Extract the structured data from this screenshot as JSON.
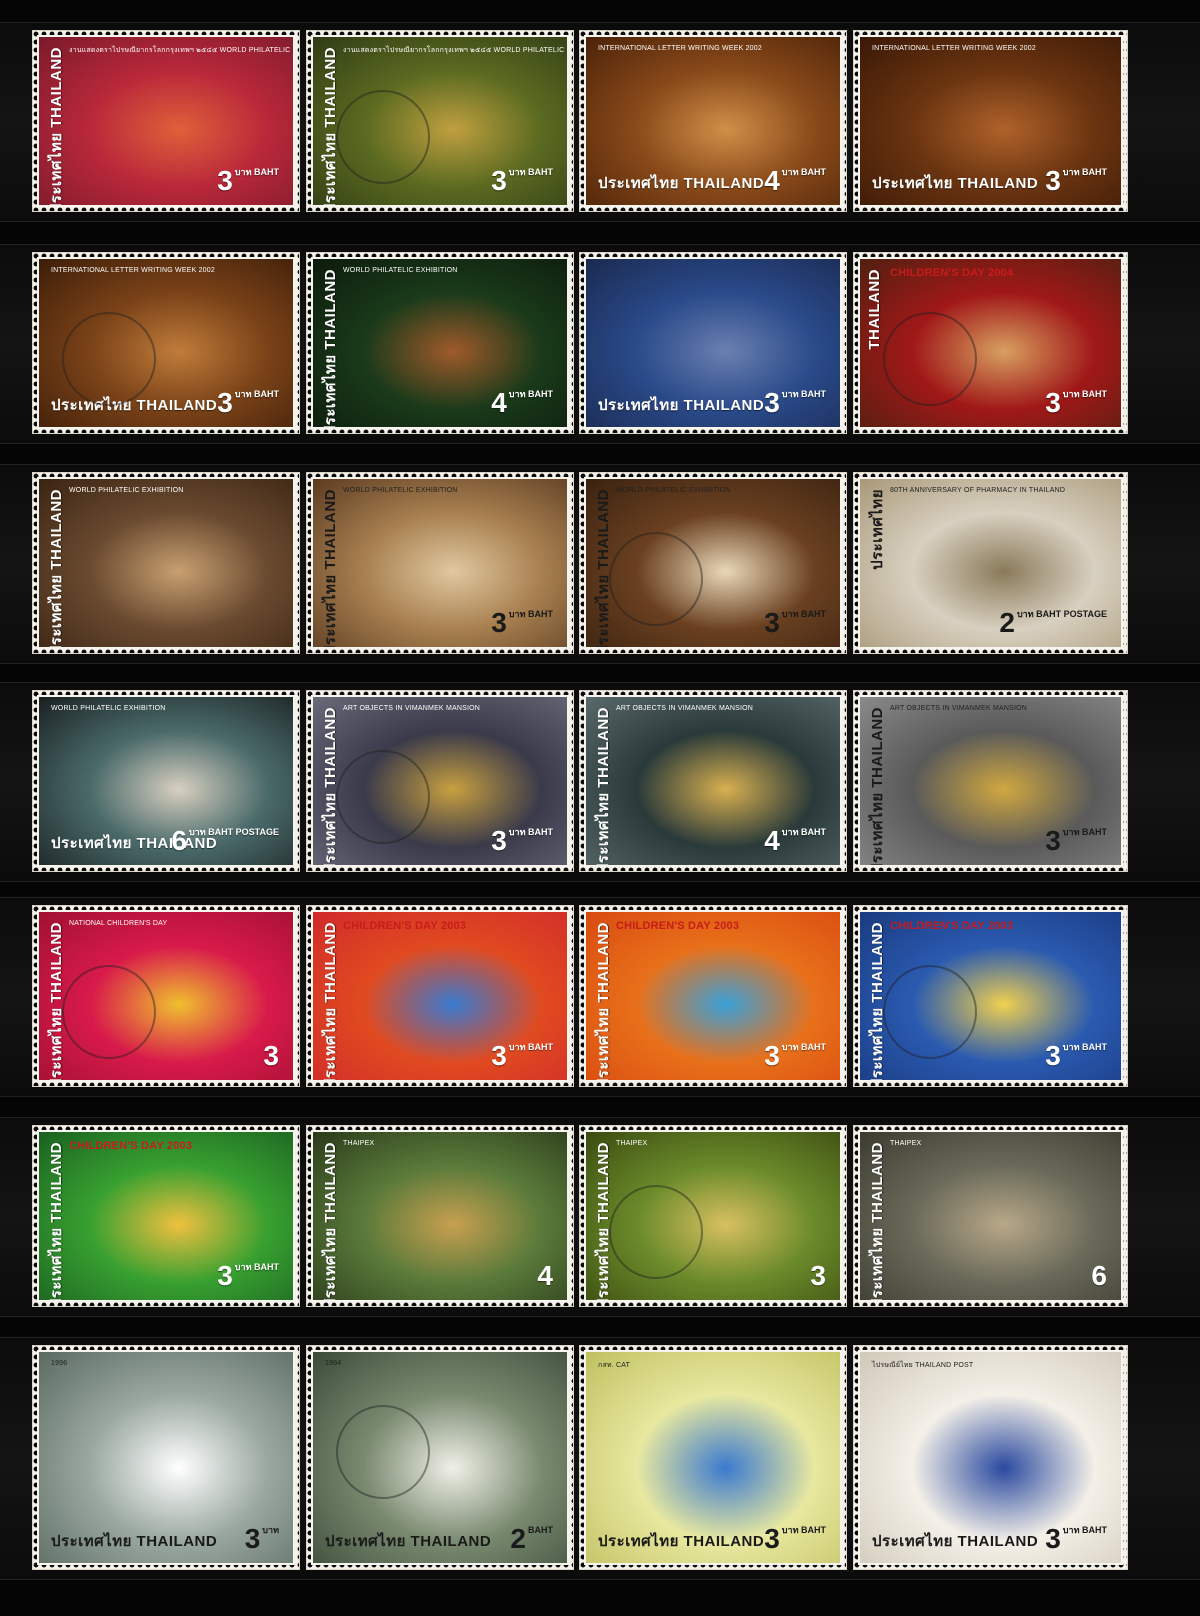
{
  "album": {
    "rows": [
      {
        "stamps": [
          {
            "country": "ประเทศไทย THAILAND",
            "value": "3",
            "unit": "บาท BAHT",
            "caption": "งานแสดงตราไปรษณียากรโลกกรุงเทพฯ ๒๕๔๕ WORLD PHILATELIC EXHIBITION",
            "theme": "food-red"
          },
          {
            "country": "ประเทศไทย THAILAND",
            "value": "3",
            "unit": "บาท BAHT",
            "caption": "งานแสดงตราไปรษณียากรโลกกรุงเทพฯ ๒๕๔๕ WORLD PHILATELIC EXHIBITION",
            "theme": "food-green"
          },
          {
            "country": "ประเทศไทย THAILAND",
            "value": "4",
            "unit": "บาท BAHT",
            "caption": "INTERNATIONAL LETTER WRITING WEEK 2002",
            "theme": "wood-ladle"
          },
          {
            "country": "ประเทศไทย THAILAND",
            "value": "3",
            "unit": "บาท BAHT",
            "caption": "INTERNATIONAL LETTER WRITING WEEK 2002",
            "theme": "wood-frog"
          }
        ]
      },
      {
        "stamps": [
          {
            "country": "ประเทศไทย THAILAND",
            "value": "3",
            "unit": "บาท BAHT",
            "caption": "INTERNATIONAL LETTER WRITING WEEK 2002",
            "theme": "wood-sieve"
          },
          {
            "country": "ประเทศไทย THAILAND",
            "value": "4",
            "unit": "บาท BAHT",
            "caption": "WORLD PHILATELIC EXHIBITION",
            "theme": "food-dark"
          },
          {
            "country": "ประเทศไทย THAILAND",
            "value": "3",
            "unit": "บาท BAHT",
            "caption": "",
            "theme": "painting-blue"
          },
          {
            "country": "THAILAND",
            "value": "3",
            "unit": "บาท BAHT",
            "caption": "CHILDREN'S DAY 2004",
            "theme": "cartoon-red"
          }
        ]
      },
      {
        "stamps": [
          {
            "country": "ประเทศไทย THAILAND",
            "value": "",
            "unit": "",
            "caption": "WORLD PHILATELIC EXHIBITION",
            "theme": "pottery"
          },
          {
            "country": "ประเทศไทย THAILAND",
            "value": "3",
            "unit": "บาท BAHT",
            "caption": "WORLD PHILATELIC EXHIBITION",
            "theme": "basket"
          },
          {
            "country": "ประเทศไทย THAILAND",
            "value": "3",
            "unit": "บาท BAHT",
            "caption": "WORLD PHILATELIC EXHIBITION",
            "theme": "puppet"
          },
          {
            "country": "ประเทศไทย",
            "value": "2",
            "unit": "บาท BAHT POSTAGE",
            "caption": "80TH ANNIVERSARY OF PHARMACY IN THAILAND",
            "theme": "grinder"
          }
        ]
      },
      {
        "stamps": [
          {
            "country": "ประเทศไทย THAILAND",
            "value": "6",
            "unit": "บาท BAHT POSTAGE",
            "caption": "WORLD PHILATELIC EXHIBITION",
            "theme": "vases"
          },
          {
            "country": "ประเทศไทย THAILAND",
            "value": "3",
            "unit": "บาท BAHT",
            "caption": "ART OBJECTS IN VIMANMEK MANSION",
            "theme": "gold-box"
          },
          {
            "country": "ประเทศไทย THAILAND",
            "value": "4",
            "unit": "บาท BAHT",
            "caption": "ART OBJECTS IN VIMANMEK MANSION",
            "theme": "gold-bowl"
          },
          {
            "country": "ประเทศไทย THAILAND",
            "value": "3",
            "unit": "บาท BAHT",
            "caption": "ART OBJECTS IN VIMANMEK MANSION",
            "theme": "gold-bowl2"
          }
        ]
      },
      {
        "stamps": [
          {
            "country": "ประเทศไทย THAILAND",
            "value": "3",
            "unit": "",
            "caption": "NATIONAL CHILDREN'S DAY",
            "theme": "kids-red"
          },
          {
            "country": "ประเทศไทย THAILAND",
            "value": "3",
            "unit": "บาท BAHT",
            "caption": "CHILDREN'S DAY 2003",
            "theme": "kids-temple"
          },
          {
            "country": "ประเทศไทย THAILAND",
            "value": "3",
            "unit": "บาท BAHT",
            "caption": "CHILDREN'S DAY 2003",
            "theme": "kids-city"
          },
          {
            "country": "ประเทศไทย THAILAND",
            "value": "3",
            "unit": "บาท BAHT",
            "caption": "CHILDREN'S DAY 2003",
            "theme": "kids-swing"
          }
        ]
      },
      {
        "stamps": [
          {
            "country": "ประเทศไทย THAILAND",
            "value": "3",
            "unit": "บาท BAHT",
            "caption": "CHILDREN'S DAY 2003",
            "theme": "kids-green"
          },
          {
            "country": "ประเทศไทย THAILAND",
            "value": "4",
            "unit": "",
            "caption": "THAIPEX",
            "theme": "rooster1"
          },
          {
            "country": "ประเทศไทย THAILAND",
            "value": "3",
            "unit": "",
            "caption": "THAIPEX",
            "theme": "rooster2"
          },
          {
            "country": "ประเทศไทย THAILAND",
            "value": "6",
            "unit": "",
            "caption": "THAIPEX",
            "theme": "rooster3"
          }
        ]
      },
      {
        "stamps": [
          {
            "country": "ประเทศไทย THAILAND",
            "value": "3",
            "unit": "บาท",
            "caption": "1996",
            "theme": "dino1"
          },
          {
            "country": "ประเทศไทย THAILAND",
            "value": "2",
            "unit": "BAHT",
            "caption": "1994",
            "theme": "dino2"
          },
          {
            "country": "ประเทศไทย THAILAND",
            "value": "3",
            "unit": "บาท BAHT",
            "caption": "กสท. CAT",
            "theme": "cat25"
          },
          {
            "country": "ประเทศไทย THAILAND",
            "value": "3",
            "unit": "บาท BAHT",
            "caption": "ไปรษณีย์ไทย THAILAND POST",
            "theme": "post"
          }
        ]
      }
    ]
  },
  "colors": {
    "background": "#050505",
    "paper": "#f4f1ea"
  }
}
